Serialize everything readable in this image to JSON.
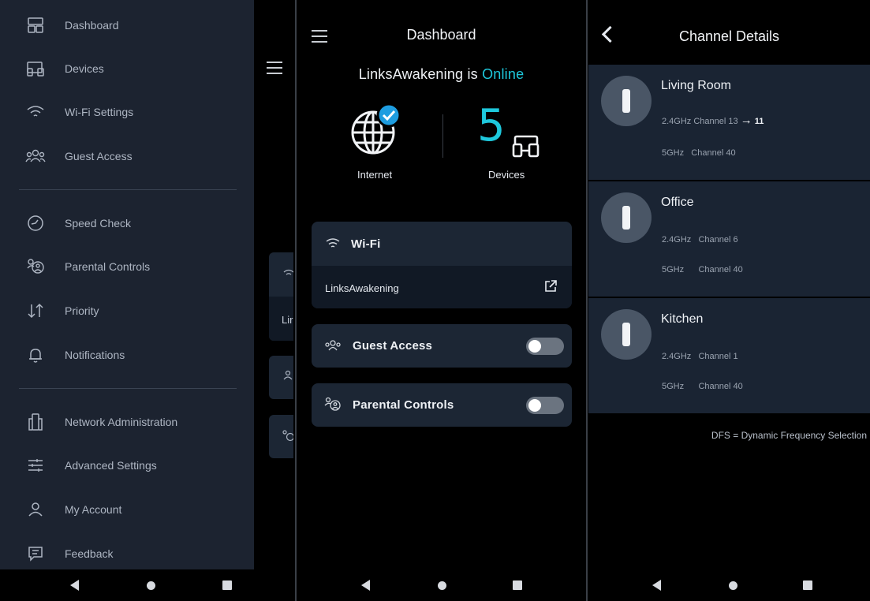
{
  "drawer": {
    "items": [
      {
        "label": "Dashboard",
        "icon": "dashboard-icon"
      },
      {
        "label": "Devices",
        "icon": "devices-icon"
      },
      {
        "label": "Wi-Fi Settings",
        "icon": "wifi-icon"
      },
      {
        "label": "Guest Access",
        "icon": "guest-access-icon"
      },
      {
        "label": "Speed Check",
        "icon": "speed-check-icon"
      },
      {
        "label": "Parental Controls",
        "icon": "parental-controls-icon"
      },
      {
        "label": "Priority",
        "icon": "priority-icon"
      },
      {
        "label": "Notifications",
        "icon": "bell-icon"
      },
      {
        "label": "Network Administration",
        "icon": "network-admin-icon"
      },
      {
        "label": "Advanced Settings",
        "icon": "sliders-icon"
      },
      {
        "label": "My Account",
        "icon": "user-icon"
      },
      {
        "label": "Feedback",
        "icon": "feedback-icon"
      }
    ],
    "ghost_wifi_text": "Lir"
  },
  "dashboard": {
    "title": "Dashboard",
    "network_name": "LinksAwakening",
    "status_prefix": "is",
    "status": "Online",
    "internet_label": "Internet",
    "device_count": "5",
    "devices_label": "Devices",
    "wifi_title": "Wi-Fi",
    "wifi_network": "LinksAwakening",
    "guest_access_label": "Guest Access",
    "guest_access_on": false,
    "parental_controls_label": "Parental Controls",
    "parental_controls_on": false
  },
  "channel_details": {
    "title": "Channel Details",
    "nodes": [
      {
        "name": "Living Room",
        "band24": "2.4GHz",
        "ch24": "Channel 13",
        "ch24_arrow": "→",
        "ch24_new": "11",
        "band5": "5GHz",
        "ch5": "Channel 40"
      },
      {
        "name": "Office",
        "band24": "2.4GHz",
        "ch24": "Channel 6",
        "band5": "5GHz",
        "ch5": "Channel 40"
      },
      {
        "name": "Kitchen",
        "band24": "2.4GHz",
        "ch24": "Channel 1",
        "band5": "5GHz",
        "ch5": "Channel 40"
      }
    ],
    "footnote": "DFS = Dynamic Frequency Selection"
  },
  "colors": {
    "accent": "#1ec8dc",
    "panel": "#1c2330",
    "card": "#1c2634"
  }
}
